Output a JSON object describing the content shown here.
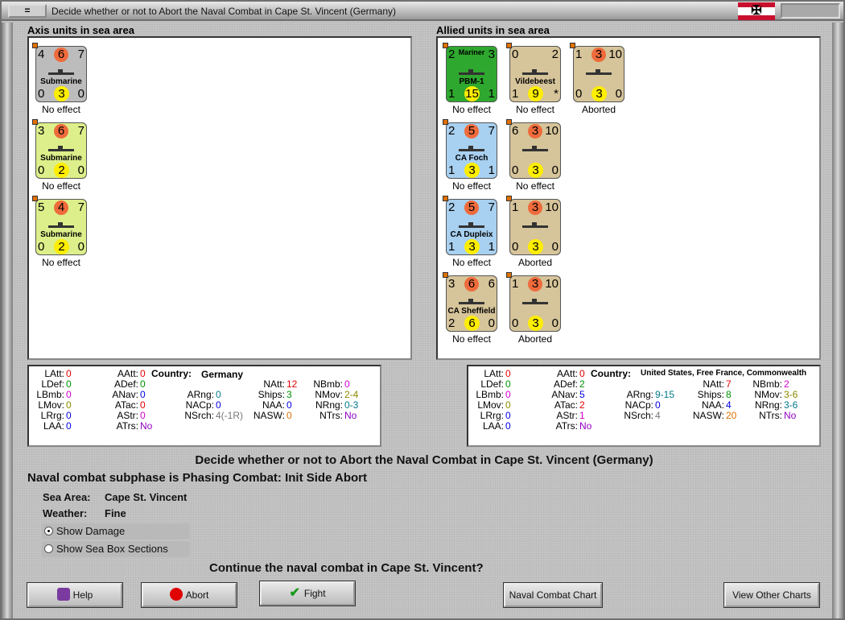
{
  "window": {
    "title": "Decide whether or not to Abort the Naval Combat in Cape St. Vincent (Germany)",
    "sys_button": "=",
    "flag_symbol": "✠"
  },
  "axis": {
    "title": "Axis units in sea area",
    "units": [
      {
        "tl": "4",
        "circle": "6",
        "tr": "7",
        "name": "Submarine",
        "bl": "0",
        "ycircle": "3",
        "br": "0",
        "result": "No effect",
        "color": "#bcbcbc"
      },
      {
        "tl": "3",
        "circle": "6",
        "tr": "7",
        "name": "Submarine",
        "bl": "0",
        "ycircle": "2",
        "br": "0",
        "result": "No effect",
        "color": "#dcef8a"
      },
      {
        "tl": "5",
        "circle": "4",
        "tr": "7",
        "name": "Submarine",
        "bl": "0",
        "ycircle": "2",
        "br": "0",
        "result": "No effect",
        "color": "#dcef8a"
      }
    ]
  },
  "allied": {
    "title": "Allied units in sea area",
    "units": [
      {
        "tl": "2",
        "label": "Mariner",
        "tr": "3",
        "name": "PBM-1",
        "bl": "1",
        "ycircle": "15",
        "br": "1",
        "result": "No effect",
        "color": "#2ea82e"
      },
      {
        "tl": "0",
        "tr": "2",
        "name": "Vildebeest",
        "bl": "1",
        "ycircle": "9",
        "br": "*",
        "result": "No effect",
        "color": "#d6c49a"
      },
      {
        "tl": "1",
        "circle": "3",
        "tr": "10",
        "name": "",
        "bl": "0",
        "ycircle": "3",
        "br": "0",
        "result": "Aborted",
        "color": "#d6c49a"
      },
      {
        "tl": "2",
        "circle": "5",
        "tr": "7",
        "name": "CA Foch",
        "bl": "1",
        "ycircle": "3",
        "br": "1",
        "result": "No effect",
        "color": "#a8d0f0"
      },
      {
        "tl": "6",
        "circle": "3",
        "tr": "10",
        "name": "",
        "bl": "0",
        "ycircle": "3",
        "br": "0",
        "result": "No effect",
        "color": "#d6c49a"
      },
      {
        "tl": "2",
        "circle": "5",
        "tr": "7",
        "name": "CA Dupleix",
        "bl": "1",
        "ycircle": "3",
        "br": "1",
        "result": "No effect",
        "color": "#a8d0f0"
      },
      {
        "tl": "1",
        "circle": "3",
        "tr": "10",
        "name": "",
        "bl": "0",
        "ycircle": "3",
        "br": "0",
        "result": "Aborted",
        "color": "#d6c49a"
      },
      {
        "tl": "3",
        "circle": "6",
        "tr": "6",
        "name": "CA Sheffield",
        "bl": "2",
        "ycircle": "6",
        "br": "0",
        "result": "No effect",
        "color": "#d6c49a"
      },
      {
        "tl": "1",
        "circle": "3",
        "tr": "10",
        "name": "",
        "bl": "0",
        "ycircle": "3",
        "br": "0",
        "result": "Aborted",
        "color": "#d6c49a"
      }
    ]
  },
  "axis_stats": {
    "country_label": "Country:",
    "country": "Germany",
    "latt": "0",
    "ldef": "0",
    "lbmb": "0",
    "lmov": "0",
    "lrrg": "0",
    "laa": "0",
    "aatt": "0",
    "adef": "0",
    "anav": "0",
    "atac": "0",
    "astr": "0",
    "atrs": "No",
    "arng": "0",
    "nacp": "0",
    "nsrch": "4(-1R)",
    "natt": "12",
    "ships": "3",
    "naa": "0",
    "nasw": "0",
    "nbmb": "0",
    "nmov": "2-4",
    "nrng": "0-3",
    "ntrs": "No"
  },
  "allied_stats": {
    "country_label": "Country:",
    "country": "United States, Free France, Commonwealth",
    "latt": "0",
    "ldef": "0",
    "lbmb": "0",
    "lmov": "0",
    "lrrg": "0",
    "laa": "0",
    "aatt": "0",
    "adef": "2",
    "anav": "5",
    "atac": "2",
    "astr": "1",
    "atrs": "No",
    "arng": "9-15",
    "nacp": "0",
    "nsrch": "4",
    "natt": "7",
    "ships": "8",
    "naa": "4",
    "nasw": "20",
    "nbmb": "2",
    "nmov": "3-6",
    "nrng": "3-6",
    "ntrs": "No"
  },
  "stat_labels": {
    "latt": "LAtt:",
    "ldef": "LDef:",
    "lbmb": "LBmb:",
    "lmov": "LMov:",
    "lrrg": "LRrg:",
    "laa": "LAA:",
    "aatt": "AAtt:",
    "adef": "ADef:",
    "anav": "ANav:",
    "atac": "ATac:",
    "astr": "AStr:",
    "atrs": "ATrs:",
    "arng": "ARng:",
    "nacp": "NACp:",
    "nsrch": "NSrch:",
    "natt": "NAtt:",
    "ships": "Ships:",
    "naa": "NAA:",
    "nasw": "NASW:",
    "nbmb": "NBmb:",
    "nmov": "NMov:",
    "nrng": "NRng:",
    "ntrs": "NTrs:"
  },
  "main": {
    "heading": "Decide whether or not to Abort the Naval Combat in Cape St. Vincent (Germany)",
    "subphase": "Naval combat subphase is Phasing Combat: Init Side Abort",
    "sea_area_label": "Sea Area:",
    "sea_area": "Cape St. Vincent",
    "weather_label": "Weather:",
    "weather": "Fine",
    "show_damage": "Show Damage",
    "show_sea_box": "Show Sea Box Sections",
    "question": "Continue the naval combat in Cape St. Vincent?"
  },
  "buttons": {
    "help": "Help",
    "abort": "Abort",
    "fight": "Fight",
    "naval_chart": "Naval Combat Chart",
    "other_charts": "View Other Charts"
  },
  "icons": {
    "help": "book-icon",
    "abort": "no-entry-icon",
    "fight": "checkmark-icon"
  },
  "colors": {
    "abort_icon": "#e00000",
    "fight_icon": "#1a9a1a",
    "help_icon": "#7a3aa0"
  }
}
